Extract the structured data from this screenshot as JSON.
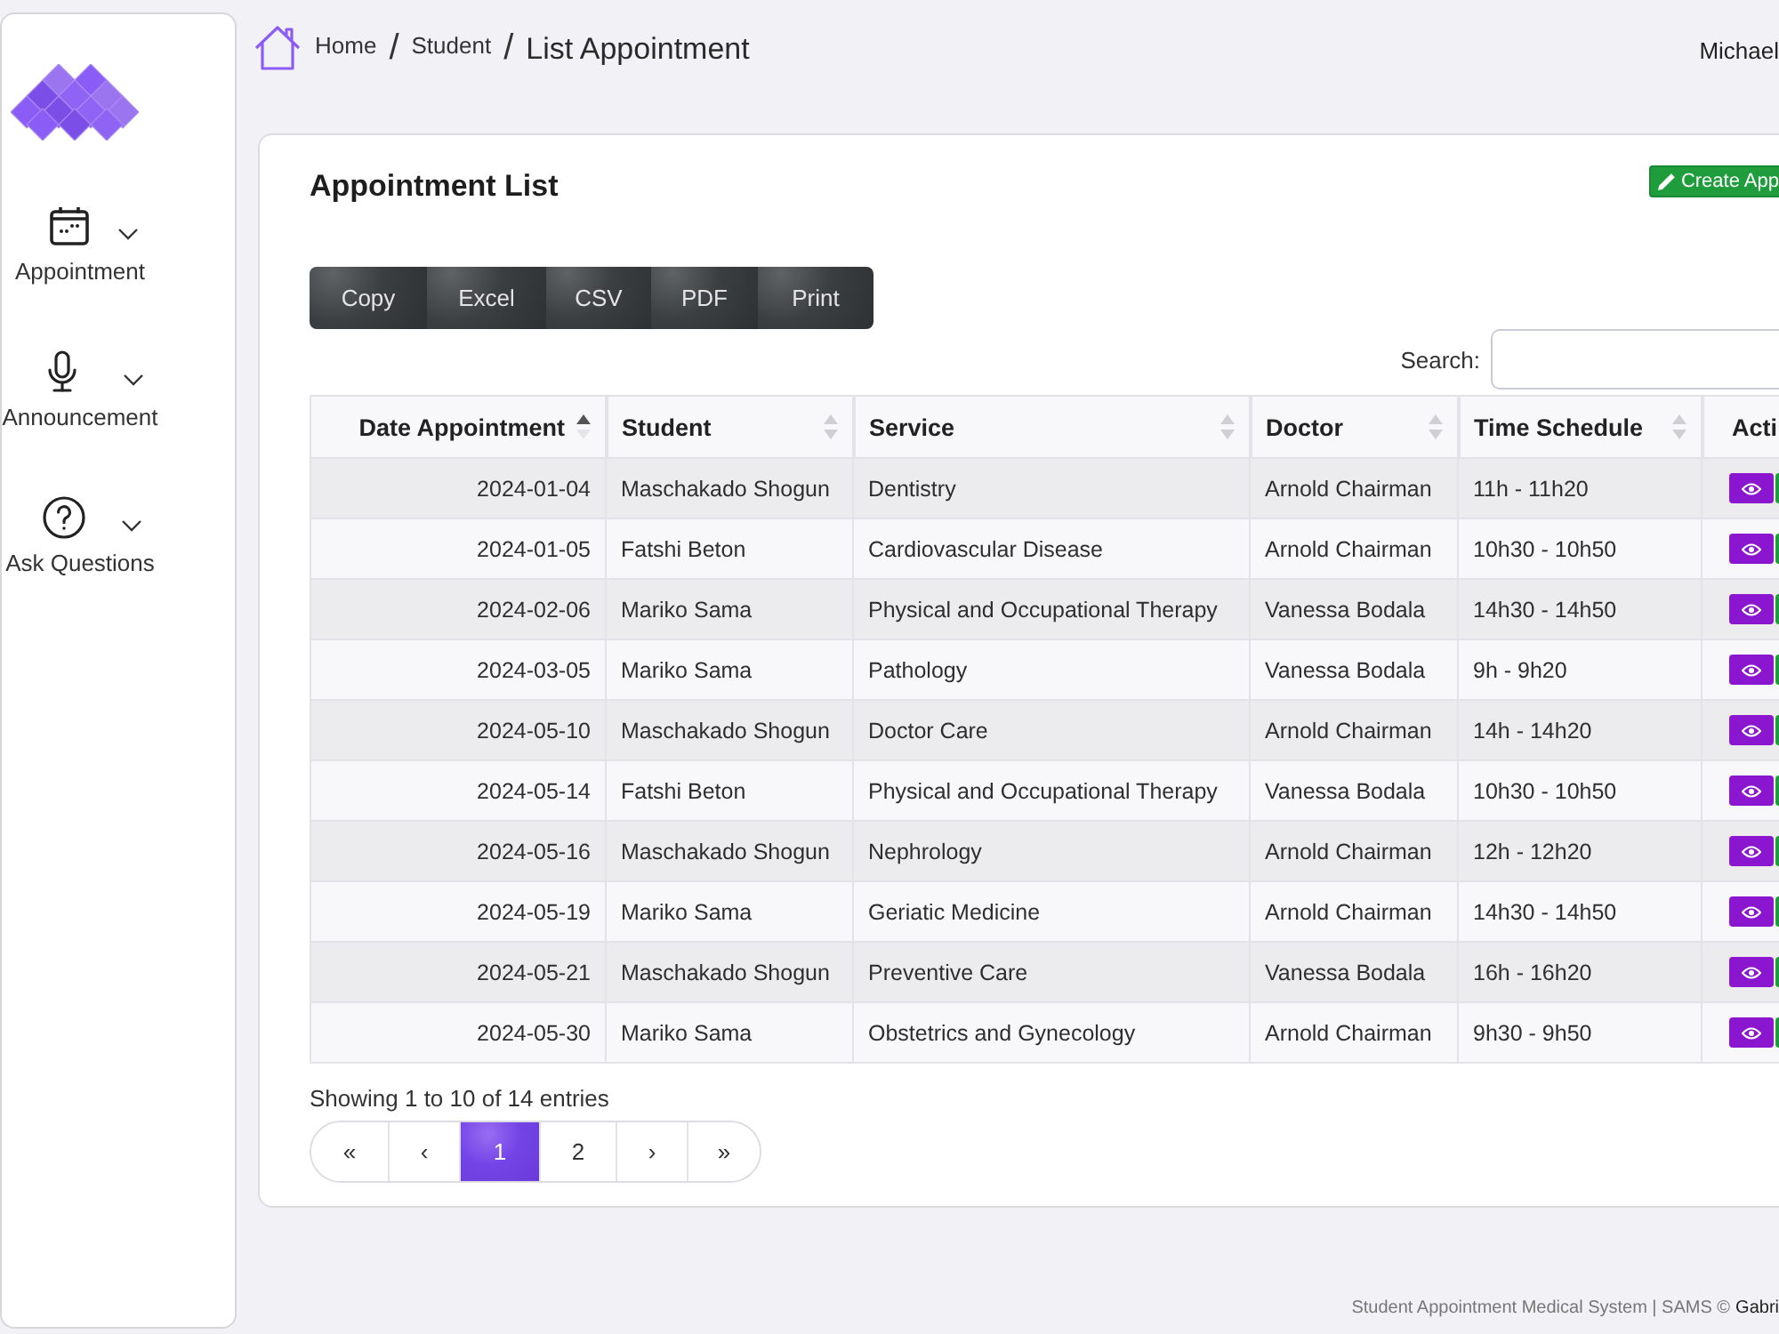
{
  "sidebar": {
    "items": [
      {
        "label": "Appointment"
      },
      {
        "label": "Announcement"
      },
      {
        "label": "Ask Questions"
      }
    ]
  },
  "breadcrumb": [
    {
      "label": "Home",
      "current": false
    },
    {
      "separator": "/",
      "label": "Student",
      "current": false
    },
    {
      "separator": "/",
      "label": "List Appointment",
      "current": true
    }
  ],
  "user": {
    "name": "Michael"
  },
  "card": {
    "title": "Appointment List",
    "create_button": "Create App"
  },
  "export_buttons": [
    "Copy",
    "Excel",
    "CSV",
    "PDF",
    "Print"
  ],
  "search": {
    "label": "Search:"
  },
  "table": {
    "columns": [
      {
        "label": "Date Appointment",
        "sortable": true,
        "sorted": true
      },
      {
        "label": "Student",
        "sortable": true,
        "sorted": false
      },
      {
        "label": "Service",
        "sortable": true,
        "sorted": false
      },
      {
        "label": "Doctor",
        "sortable": true,
        "sorted": false
      },
      {
        "label": "Time Schedule",
        "sortable": true,
        "sorted": false
      },
      {
        "label": "Acti",
        "sortable": false,
        "sorted": false
      }
    ],
    "rows": [
      [
        "2024-01-04",
        "Maschakado Shogun",
        "Dentistry",
        "Arnold Chairman",
        "11h - 11h20"
      ],
      [
        "2024-01-05",
        "Fatshi Beton",
        "Cardiovascular Disease",
        "Arnold Chairman",
        "10h30 - 10h50"
      ],
      [
        "2024-02-06",
        "Mariko Sama",
        "Physical and Occupational Therapy",
        "Vanessa Bodala",
        "14h30 - 14h50"
      ],
      [
        "2024-03-05",
        "Mariko Sama",
        "Pathology",
        "Vanessa Bodala",
        "9h - 9h20"
      ],
      [
        "2024-05-10",
        "Maschakado Shogun",
        "Doctor Care",
        "Arnold Chairman",
        "14h - 14h20"
      ],
      [
        "2024-05-14",
        "Fatshi Beton",
        "Physical and Occupational Therapy",
        "Vanessa Bodala",
        "10h30 - 10h50"
      ],
      [
        "2024-05-16",
        "Maschakado Shogun",
        "Nephrology",
        "Arnold Chairman",
        "12h - 12h20"
      ],
      [
        "2024-05-19",
        "Mariko Sama",
        "Geriatic Medicine",
        "Arnold Chairman",
        "14h30 - 14h50"
      ],
      [
        "2024-05-21",
        "Maschakado Shogun",
        "Preventive Care",
        "Vanessa Bodala",
        "16h - 16h20"
      ],
      [
        "2024-05-30",
        "Mariko Sama",
        "Obstetrics and Gynecology",
        "Arnold Chairman",
        "9h30 - 9h50"
      ]
    ]
  },
  "info": "Showing 1 to 10 of 14 entries",
  "pagination": [
    {
      "label": "«",
      "selected": false
    },
    {
      "label": "‹",
      "selected": false
    },
    {
      "label": "1",
      "selected": true
    },
    {
      "label": "2",
      "selected": false
    },
    {
      "label": "›",
      "selected": false
    },
    {
      "label": "»",
      "selected": false
    }
  ],
  "footer": {
    "text": "Student Appointment Medical System | SAMS ©",
    "author": "Gabri"
  }
}
